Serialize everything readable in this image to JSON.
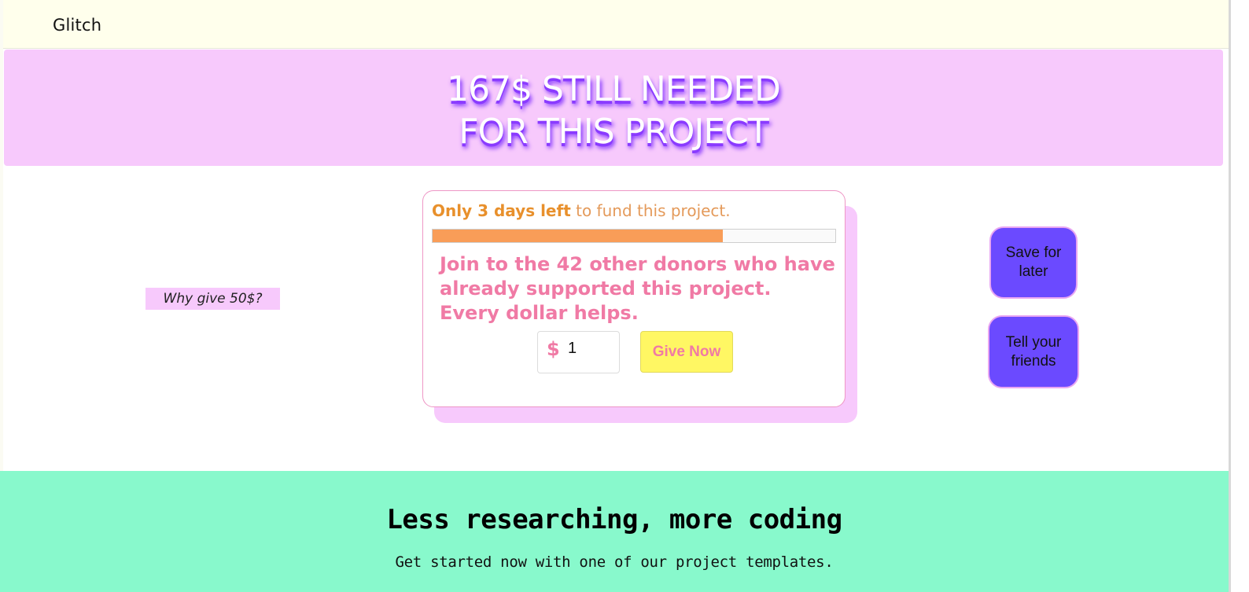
{
  "header": {
    "brand": "Glitch"
  },
  "banner": {
    "line1": "167$ STILL NEEDED",
    "line2": "FOR THIS PROJECT"
  },
  "card": {
    "days_strong": "Only 3 days left",
    "days_rest": " to fund this project.",
    "progress_fraction": 0.72,
    "donors_line1": "Join to the 42 other donors who have",
    "donors_line2": "already supported this project.",
    "donors_line3": "Every dollar helps.",
    "currency_symbol": "$",
    "amount_value": "1",
    "give_button_label": "Give Now"
  },
  "why_give": {
    "label": "Why give 50$?"
  },
  "side_buttons": {
    "save_line1": "Save for",
    "save_line2": "later",
    "tell_line1": "Tell your",
    "tell_line2": "friends"
  },
  "footer_section": {
    "title": "Less researching, more coding",
    "subtitle": "Get started now with one of our project templates."
  },
  "colors": {
    "banner_bg": "#f7c9fc",
    "progress_fill": "#f99d58",
    "donor_text": "#f07aa5",
    "give_button_bg": "#fff763",
    "side_button_bg": "#6b4aff",
    "bottom_bg": "#88f9cc",
    "topbar_bg": "#ffffec"
  }
}
